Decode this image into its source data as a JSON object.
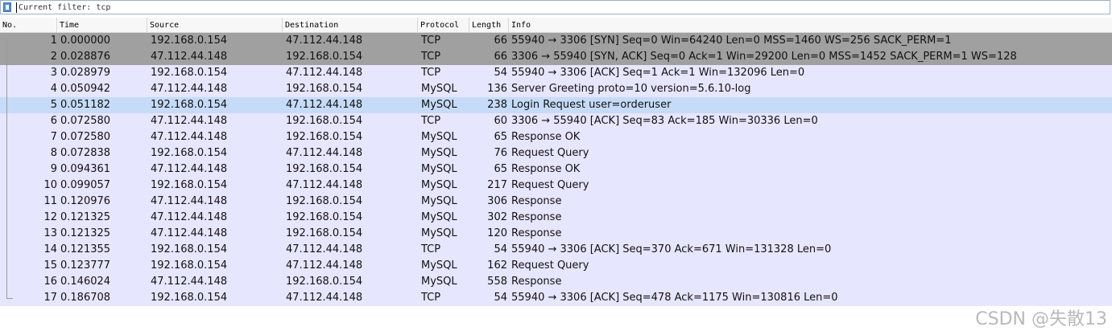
{
  "filter": {
    "text": "Current filter: tcp"
  },
  "columns": {
    "no": "No.",
    "time": "Time",
    "source": "Source",
    "destination": "Destination",
    "protocol": "Protocol",
    "length": "Length",
    "info": "Info"
  },
  "colors": {
    "tcp_handshake_bg": "#a0a0a0",
    "normal_bg": "#e7e6ff",
    "selected_bg": "#c6dbf8"
  },
  "packets": [
    {
      "no": "1",
      "time": "0.000000",
      "src": "192.168.0.154",
      "dst": "47.112.44.148",
      "proto": "TCP",
      "len": "66",
      "info": "55940 → 3306 [SYN] Seq=0 Win=64240 Len=0 MSS=1460 WS=256 SACK_PERM=1",
      "style": "tcp_handshake"
    },
    {
      "no": "2",
      "time": "0.028876",
      "src": "47.112.44.148",
      "dst": "192.168.0.154",
      "proto": "TCP",
      "len": "66",
      "info": "3306 → 55940 [SYN, ACK] Seq=0 Ack=1 Win=29200 Len=0 MSS=1452 SACK_PERM=1 WS=128",
      "style": "tcp_handshake"
    },
    {
      "no": "3",
      "time": "0.028979",
      "src": "192.168.0.154",
      "dst": "47.112.44.148",
      "proto": "TCP",
      "len": "54",
      "info": "55940 → 3306 [ACK] Seq=1 Ack=1 Win=132096 Len=0",
      "style": "normal"
    },
    {
      "no": "4",
      "time": "0.050942",
      "src": "47.112.44.148",
      "dst": "192.168.0.154",
      "proto": "MySQL",
      "len": "136",
      "info": "Server Greeting proto=10 version=5.6.10-log",
      "style": "normal"
    },
    {
      "no": "5",
      "time": "0.051182",
      "src": "192.168.0.154",
      "dst": "47.112.44.148",
      "proto": "MySQL",
      "len": "238",
      "info": "Login Request user=orderuser",
      "style": "selected"
    },
    {
      "no": "6",
      "time": "0.072580",
      "src": "47.112.44.148",
      "dst": "192.168.0.154",
      "proto": "TCP",
      "len": "60",
      "info": "3306 → 55940 [ACK] Seq=83 Ack=185 Win=30336 Len=0",
      "style": "normal"
    },
    {
      "no": "7",
      "time": "0.072580",
      "src": "47.112.44.148",
      "dst": "192.168.0.154",
      "proto": "MySQL",
      "len": "65",
      "info": "Response OK",
      "style": "normal"
    },
    {
      "no": "8",
      "time": "0.072838",
      "src": "192.168.0.154",
      "dst": "47.112.44.148",
      "proto": "MySQL",
      "len": "76",
      "info": "Request Query",
      "style": "normal"
    },
    {
      "no": "9",
      "time": "0.094361",
      "src": "47.112.44.148",
      "dst": "192.168.0.154",
      "proto": "MySQL",
      "len": "65",
      "info": "Response OK",
      "style": "normal"
    },
    {
      "no": "10",
      "time": "0.099057",
      "src": "192.168.0.154",
      "dst": "47.112.44.148",
      "proto": "MySQL",
      "len": "217",
      "info": "Request Query",
      "style": "normal"
    },
    {
      "no": "11",
      "time": "0.120976",
      "src": "47.112.44.148",
      "dst": "192.168.0.154",
      "proto": "MySQL",
      "len": "306",
      "info": "Response",
      "style": "normal"
    },
    {
      "no": "12",
      "time": "0.121325",
      "src": "47.112.44.148",
      "dst": "192.168.0.154",
      "proto": "MySQL",
      "len": "302",
      "info": "Response",
      "style": "normal"
    },
    {
      "no": "13",
      "time": "0.121325",
      "src": "47.112.44.148",
      "dst": "192.168.0.154",
      "proto": "MySQL",
      "len": "120",
      "info": "Response",
      "style": "normal"
    },
    {
      "no": "14",
      "time": "0.121355",
      "src": "192.168.0.154",
      "dst": "47.112.44.148",
      "proto": "TCP",
      "len": "54",
      "info": "55940 → 3306 [ACK] Seq=370 Ack=671 Win=131328 Len=0",
      "style": "normal"
    },
    {
      "no": "15",
      "time": "0.123777",
      "src": "192.168.0.154",
      "dst": "47.112.44.148",
      "proto": "MySQL",
      "len": "162",
      "info": "Request Query",
      "style": "normal"
    },
    {
      "no": "16",
      "time": "0.146024",
      "src": "47.112.44.148",
      "dst": "192.168.0.154",
      "proto": "MySQL",
      "len": "558",
      "info": "Response",
      "style": "normal"
    },
    {
      "no": "17",
      "time": "0.186708",
      "src": "192.168.0.154",
      "dst": "47.112.44.148",
      "proto": "TCP",
      "len": "54",
      "info": "55940 → 3306 [ACK] Seq=478 Ack=1175 Win=130816 Len=0",
      "style": "normal"
    }
  ],
  "watermark": "CSDN @失散13"
}
